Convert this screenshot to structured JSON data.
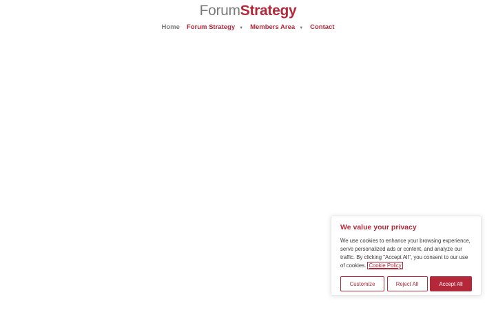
{
  "logo": {
    "part1": "Forum",
    "part2": "Strategy"
  },
  "nav": {
    "items": [
      {
        "label": "Home"
      },
      {
        "label": "Forum Strategy",
        "has_dropdown": true
      },
      {
        "label": "Members Area",
        "has_dropdown": true
      },
      {
        "label": "Contact"
      }
    ],
    "dropdown_glyph": "▼"
  },
  "cookie_banner": {
    "title": "We value your privacy",
    "text": "We use cookies to enhance your browsing experience, serve personalized ads or content, and analyze our traffic. By clicking \"Accept All\", you consent to our use of cookies.",
    "policy_link": "Cookie Policy",
    "buttons": {
      "customize": "Customize",
      "reject": "Reject All",
      "accept": "Accept All"
    }
  },
  "colors": {
    "brand": "#b5283a",
    "grey": "#7a7a7a"
  }
}
